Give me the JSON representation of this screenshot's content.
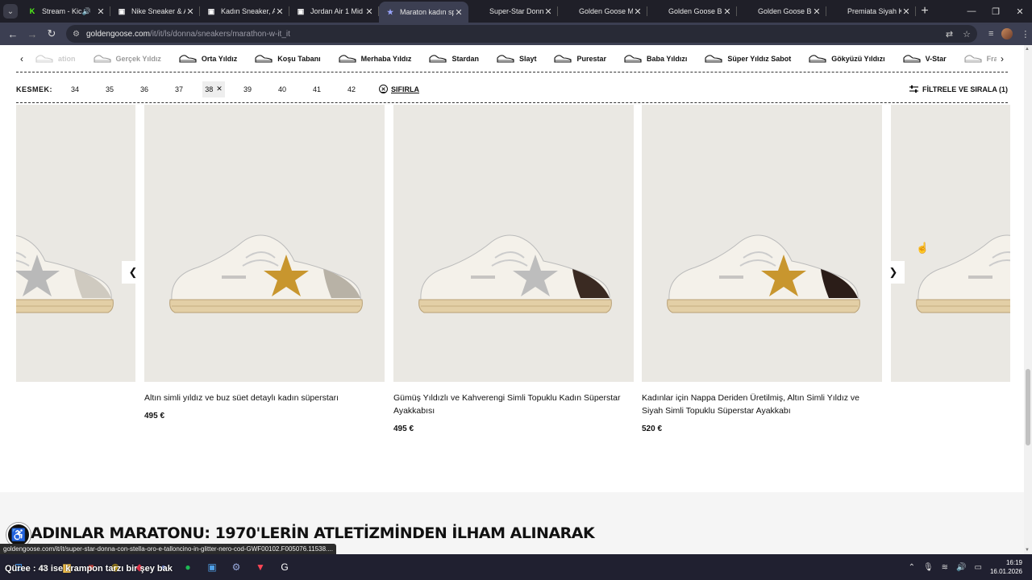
{
  "tabs": [
    {
      "title": "Stream - Kick",
      "fav": "K",
      "fav_color": "#53fc18",
      "audio": true
    },
    {
      "title": "Nike Sneaker & A",
      "fav": "▣",
      "fav_color": "#ffffff"
    },
    {
      "title": "Kadın Sneaker, Ay",
      "fav": "▣",
      "fav_color": "#ffffff"
    },
    {
      "title": "Jordan Air 1 Mid",
      "fav": "▣",
      "fav_color": "#ffffff"
    },
    {
      "title": "Maraton kadın sp",
      "fav": "★",
      "fav_color": "#9aa6ff",
      "active": true
    },
    {
      "title": "Super-Star Donna",
      "fav": "",
      "fav_color": "#ffffff"
    },
    {
      "title": "Golden Goose Ma",
      "fav": "",
      "fav_color": "#ffffff"
    },
    {
      "title": "Golden Goose Be",
      "fav": "",
      "fav_color": "#ffffff"
    },
    {
      "title": "Golden Goose Be",
      "fav": "",
      "fav_color": "#ffffff"
    },
    {
      "title": "Premiata Siyah Ka",
      "fav": "",
      "fav_color": "#ffffff"
    }
  ],
  "address": {
    "domain": "goldengoose.com",
    "path": "/it/it/ls/donna/sneakers/marathon-w-it_it"
  },
  "models": [
    {
      "label": "ation",
      "style": "veryfaded"
    },
    {
      "label": "Gerçek Yıldız",
      "style": "faded"
    },
    {
      "label": "Orta Yıldız",
      "style": ""
    },
    {
      "label": "Koşu Tabanı",
      "style": ""
    },
    {
      "label": "Merhaba Yıldız",
      "style": ""
    },
    {
      "label": "Stardan",
      "style": ""
    },
    {
      "label": "Slayt",
      "style": ""
    },
    {
      "label": "Purestar",
      "style": ""
    },
    {
      "label": "Baba Yıldızı",
      "style": ""
    },
    {
      "label": "Süper Yıldız Sabot",
      "style": ""
    },
    {
      "label": "Gökyüzü Yıldızı",
      "style": ""
    },
    {
      "label": "V-Star",
      "style": ""
    },
    {
      "label": "Francy",
      "style": "faded"
    },
    {
      "label": "F",
      "style": "veryfaded"
    }
  ],
  "filter": {
    "label": "KESMEK:",
    "sizes": [
      "34",
      "35",
      "36",
      "37",
      "38",
      "39",
      "40",
      "41",
      "42"
    ],
    "selected": "38",
    "reset_label": "SIFIRLA",
    "sort_label": "FİLTRELE VE SIRALA (1)"
  },
  "products": [
    {
      "name": "",
      "price": "",
      "star_color": "#b9b9b9",
      "heel_color": "#cfcac0"
    },
    {
      "name": "Altın simli yıldız ve buz süet detaylı kadın süperstarı",
      "price": "495 €",
      "star_color": "#c8962e",
      "heel_color": "#b8b2a6"
    },
    {
      "name": "Gümüş Yıldızlı ve Kahverengi Simli Topuklu Kadın Süperstar Ayakkabısı",
      "price": "495 €",
      "star_color": "#bdbdbd",
      "heel_color": "#3a2a22"
    },
    {
      "name": "Kadınlar için Nappa Deriden Üretilmiş, Altın Simli Yıldız ve Siyah Simli Topuklu Süperstar Ayakkabı",
      "price": "520 €",
      "star_color": "#c8962e",
      "heel_color": "#2b1d18"
    },
    {
      "name": "",
      "price": "",
      "star_color": "#d8d8d8",
      "heel_color": "#2b1d18"
    }
  ],
  "story": {
    "title": "ADINLAR MARATONU: 1970'LERİN ATLETİZMİNDEN İLHAM ALINARAK"
  },
  "status_url": "goldengoose.com/it/it/super-star-donna-con-stella-oro-e-talloncino-in-glitter-nero-cod-GWF00102.F005076.11538....",
  "taskbar": {
    "news": "Qüree : 43 ise krampon tarzı bir şey bak",
    "time": "16:19",
    "date": "16.01.2026"
  }
}
